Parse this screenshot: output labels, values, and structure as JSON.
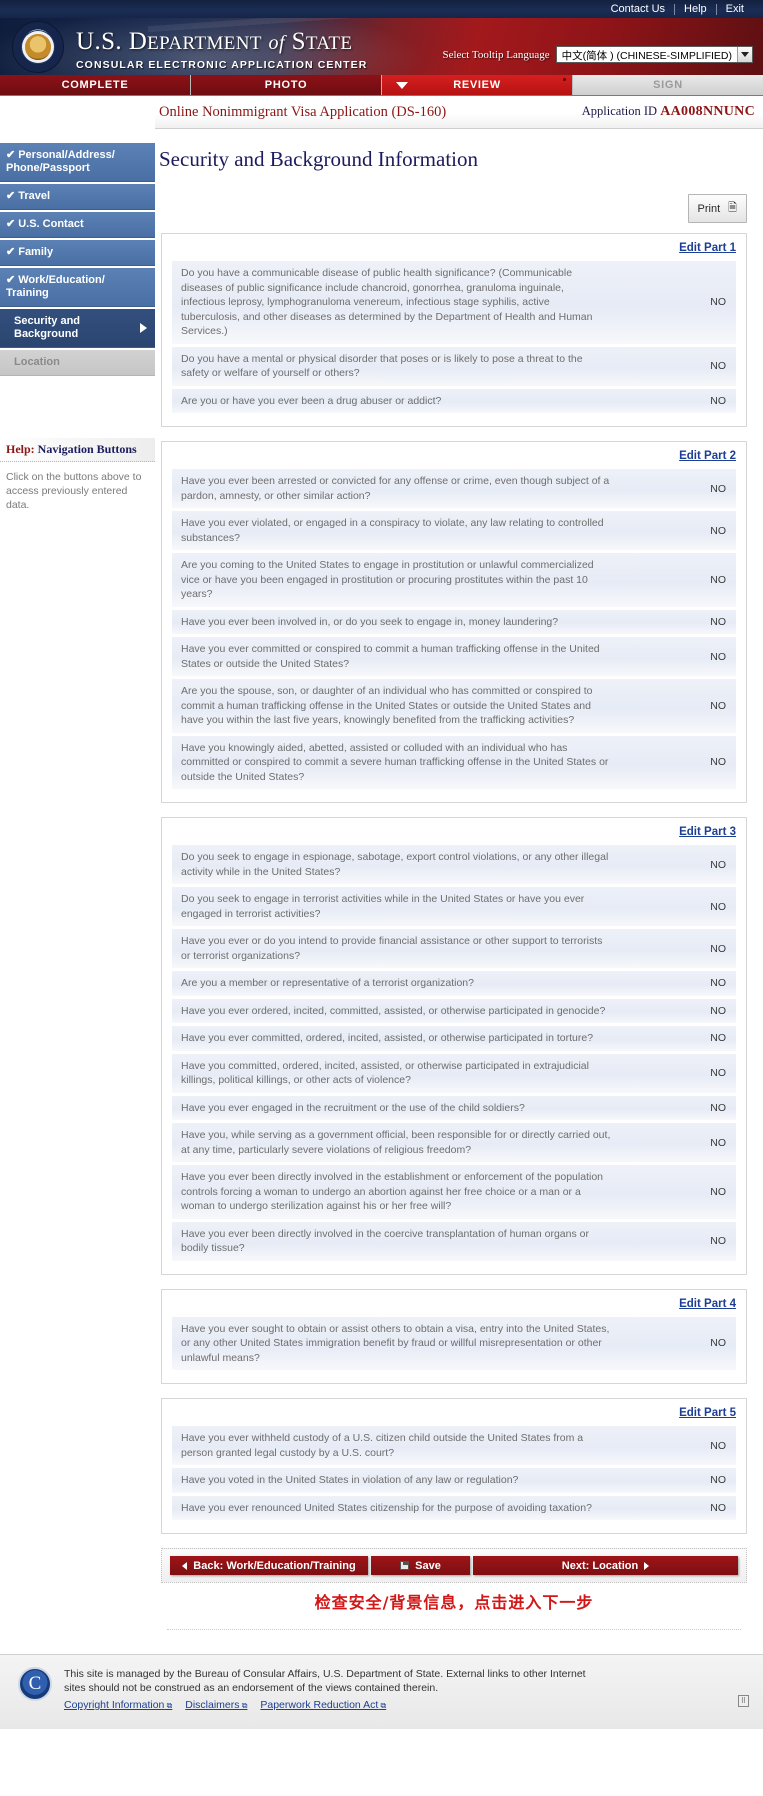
{
  "topbar": {
    "contact": "Contact Us",
    "help": "Help",
    "exit": "Exit"
  },
  "masthead": {
    "title_line1_us": "U.S. D",
    "title_line1_epartment": "EPARTMENT",
    "title_line1_of": "of",
    "title_line1_s": "S",
    "title_line1_tate": "TATE",
    "subtitle": "CONSULAR ELECTRONIC APPLICATION CENTER",
    "lang_label": "Select Tooltip Language",
    "lang_value": "中文(简体 ) (CHINESE-SIMPLIFIED)"
  },
  "tabs": [
    {
      "label": "COMPLETE",
      "state": "done"
    },
    {
      "label": "PHOTO",
      "state": "done"
    },
    {
      "label": "REVIEW",
      "state": "active"
    },
    {
      "label": "SIGN",
      "state": "todo"
    }
  ],
  "appbar": {
    "title": "Online Nonimmigrant Visa Application (DS-160)",
    "app_id_label": "Application ID",
    "app_id_value": "AA008NNUNC"
  },
  "page_title": "Security and Background Information",
  "sidebar": {
    "items": [
      {
        "label": "Personal/Address/ Phone/Passport",
        "state": "done",
        "check": "✔"
      },
      {
        "label": "Travel",
        "state": "done",
        "check": "✔"
      },
      {
        "label": "U.S. Contact",
        "state": "done",
        "check": "✔"
      },
      {
        "label": "Family",
        "state": "done",
        "check": "✔"
      },
      {
        "label": "Work/Education/ Training",
        "state": "done",
        "check": "✔"
      },
      {
        "label": "Security and Background",
        "state": "current",
        "check": ""
      },
      {
        "label": "Location",
        "state": "disabled",
        "check": ""
      }
    ],
    "help_title_word": "Help:",
    "help_title_rest": " Navigation Buttons",
    "help_body": "Click on the buttons above to access previously entered data."
  },
  "print": {
    "label": "Print",
    "icon": "print-icon"
  },
  "parts": [
    {
      "edit_label": "Edit Part 1",
      "questions": [
        {
          "text": "Do you have a communicable disease of public health significance? (Communicable diseases of public significance include chancroid, gonorrhea, granuloma inguinale, infectious leprosy, lymphogranuloma venereum, infectious stage syphilis, active tuberculosis, and other diseases as determined by the Department of Health and Human Services.)",
          "answer": "NO"
        },
        {
          "text": "Do you have a mental or physical disorder that poses or is likely to pose a threat to the safety or welfare of yourself or others?",
          "answer": "NO"
        },
        {
          "text": "Are you or have you ever been a drug abuser or addict?",
          "answer": "NO"
        }
      ]
    },
    {
      "edit_label": "Edit Part 2",
      "questions": [
        {
          "text": "Have you ever been arrested or convicted for any offense or crime, even though subject of a pardon, amnesty, or other similar action?",
          "answer": "NO"
        },
        {
          "text": "Have you ever violated, or engaged in a conspiracy to violate, any law relating to controlled substances?",
          "answer": "NO"
        },
        {
          "text": "Are you coming to the United States to engage in prostitution or unlawful commercialized vice or have you been engaged in prostitution or procuring prostitutes within the past 10 years?",
          "answer": "NO"
        },
        {
          "text": "Have you ever been involved in, or do you seek to engage in, money laundering?",
          "answer": "NO"
        },
        {
          "text": "Have you ever committed or conspired to commit a human trafficking offense in the United States or outside the United States?",
          "answer": "NO"
        },
        {
          "text": "Are you the spouse, son, or daughter of an individual who has committed or conspired to commit a human trafficking offense in the United States or outside the United States and have you within the last five years, knowingly benefited from the trafficking activities?",
          "answer": "NO"
        },
        {
          "text": "Have you knowingly aided, abetted, assisted or colluded with an individual who has committed or conspired to commit a severe human trafficking offense in the United States or outside the United States?",
          "answer": "NO"
        }
      ]
    },
    {
      "edit_label": "Edit Part 3",
      "questions": [
        {
          "text": "Do you seek to engage in espionage, sabotage, export control violations, or any other illegal activity while in the United States?",
          "answer": "NO"
        },
        {
          "text": "Do you seek to engage in terrorist activities while in the United States or have you ever engaged in terrorist activities?",
          "answer": "NO"
        },
        {
          "text": "Have you ever or do you intend to provide financial assistance or other support to terrorists or terrorist organizations?",
          "answer": "NO"
        },
        {
          "text": "Are you a member or representative of a terrorist organization?",
          "answer": "NO"
        },
        {
          "text": "Have you ever ordered, incited, committed, assisted, or otherwise participated in genocide?",
          "answer": "NO"
        },
        {
          "text": "Have you ever committed, ordered, incited, assisted, or otherwise participated in torture?",
          "answer": "NO"
        },
        {
          "text": "Have you committed, ordered, incited, assisted, or otherwise participated in extrajudicial killings, political killings, or other acts of violence?",
          "answer": "NO"
        },
        {
          "text": "Have you ever engaged in the recruitment or the use of the child soldiers?",
          "answer": "NO"
        },
        {
          "text": "Have you, while serving as a government official, been responsible for or directly carried out, at any time, particularly severe violations of religious freedom?",
          "answer": "NO"
        },
        {
          "text": "Have you ever been directly involved in the establishment or enforcement of the population controls forcing a woman to undergo an abortion against her free choice or a man or a woman to undergo sterilization against his or her free will?",
          "answer": "NO"
        },
        {
          "text": "Have you ever been directly involved in the coercive transplantation of human organs or bodily tissue?",
          "answer": "NO"
        }
      ]
    },
    {
      "edit_label": "Edit Part 4",
      "questions": [
        {
          "text": "Have you ever sought to obtain or assist others to obtain a visa, entry into the United States, or any other United States immigration benefit by fraud or willful misrepresentation or other unlawful means?",
          "answer": "NO"
        }
      ]
    },
    {
      "edit_label": "Edit Part 5",
      "questions": [
        {
          "text": "Have you ever withheld custody of a U.S. citizen child outside the United States from a person granted legal custody by a U.S. court?",
          "answer": "NO"
        },
        {
          "text": "Have you voted in the United States in violation of any law or regulation?",
          "answer": "NO"
        },
        {
          "text": "Have you ever renounced United States citizenship for the purpose of avoiding taxation?",
          "answer": "NO"
        }
      ]
    }
  ],
  "nav_buttons": {
    "back": "Back: Work/Education/Training",
    "save": "Save",
    "next": "Next: Location"
  },
  "annotation": "检查安全/背景信息，点击进入下一步",
  "footer": {
    "line1": "This site is managed by the Bureau of Consular Affairs, U.S. Department of State. External links to other Internet",
    "line2": "sites should not be construed as an endorsement of the views contained therein.",
    "links": [
      {
        "label": "Copyright Information"
      },
      {
        "label": "Disclaimers"
      },
      {
        "label": "Paperwork Reduction Act"
      }
    ]
  },
  "colors": {
    "brand_red": "#8c1515",
    "active_red": "#d61f1f",
    "nav_blue": "#4a6fa4",
    "link_blue": "#1c3f94",
    "annotation_red": "#d31616"
  }
}
